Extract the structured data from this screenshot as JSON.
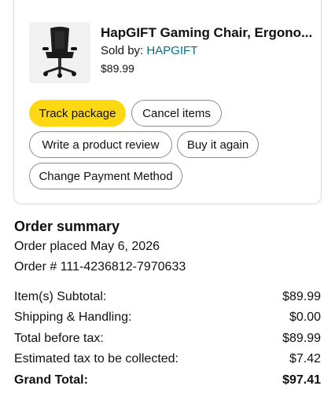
{
  "product": {
    "title": "HapGIFT Gaming Chair, Ergono...",
    "sold_by_label": "Sold by: ",
    "seller": "HAPGIFT",
    "price": "$89.99",
    "image_icon": "gaming-chair-image"
  },
  "actions": {
    "track": "Track package",
    "cancel": "Cancel items",
    "review": "Write a product review",
    "buy_again": "Buy it again",
    "change_payment": "Change Payment Method"
  },
  "summary": {
    "title": "Order summary",
    "placed": "Order placed May 6, 2026",
    "order_number": "Order # 111-4236812-7970633",
    "lines": [
      {
        "label": "Item(s) Subtotal:",
        "value": "$89.99"
      },
      {
        "label": "Shipping & Handling:",
        "value": "$0.00"
      },
      {
        "label": "Total before tax:",
        "value": "$89.99"
      },
      {
        "label": "Estimated tax to be collected:",
        "value": "$7.42"
      },
      {
        "label": "Grand Total:",
        "value": "$97.41"
      }
    ]
  },
  "colors": {
    "primary_button": "#ffd814",
    "link": "#007185",
    "border": "#d5d9d9"
  }
}
